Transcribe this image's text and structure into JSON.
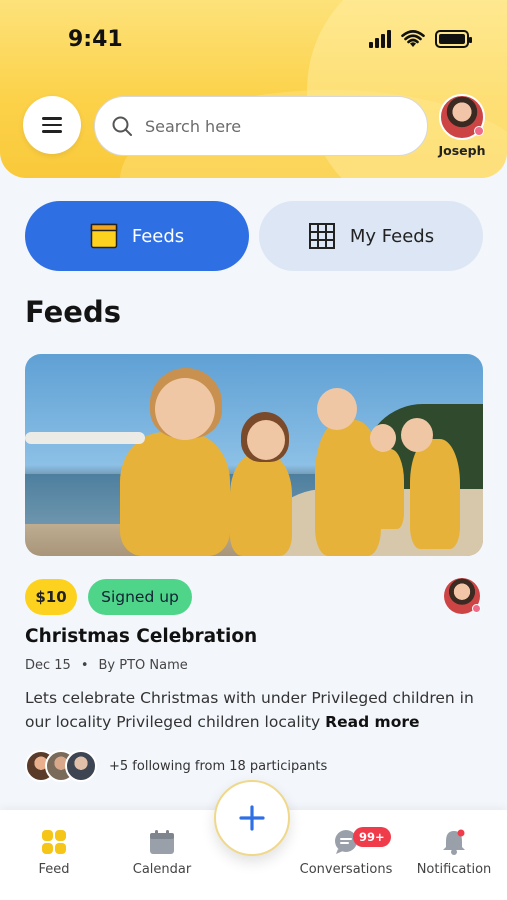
{
  "status_bar": {
    "time": "9:41"
  },
  "header": {
    "search_placeholder": "Search here",
    "profile_name": "Joseph"
  },
  "tabs": [
    {
      "label": "Feeds",
      "active": true
    },
    {
      "label": "My Feeds",
      "active": false
    }
  ],
  "section_title": "Feeds",
  "feed_card": {
    "price": "$10",
    "status": "Signed up",
    "title": "Christmas Celebration",
    "date": "Dec 15",
    "author": "By PTO Name",
    "description": "Lets celebrate Christmas with under Privileged children in our locality Privileged children locality",
    "read_more": "Read more",
    "participants_text": "+5 following from 18 participants"
  },
  "bottom_nav": {
    "items": [
      {
        "label": "Feed",
        "icon": "grid-icon",
        "active": true
      },
      {
        "label": "Calendar",
        "icon": "calendar-icon"
      },
      {
        "label": "Conversations",
        "icon": "chat-icon",
        "badge": "99+"
      },
      {
        "label": "Notification",
        "icon": "bell-icon"
      }
    ]
  },
  "colors": {
    "accent": "#2f6fe4",
    "header": "#fcd24a",
    "active_nav": "#f5c518",
    "signed_badge": "#4fd58a",
    "price_badge": "#fcd21f",
    "alert_badge": "#ef3b4a"
  }
}
